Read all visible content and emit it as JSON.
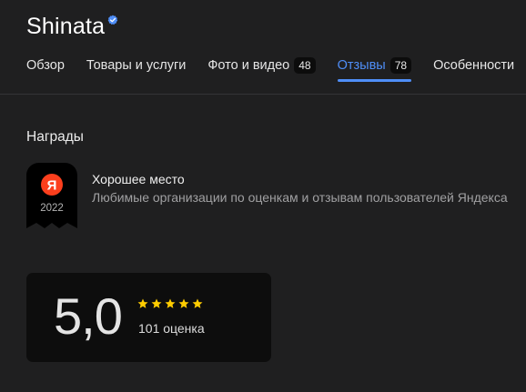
{
  "header": {
    "org_name": "Shinata",
    "verified_icon": "verified-check-icon"
  },
  "tabs": [
    {
      "label": "Обзор",
      "count": null,
      "active": false
    },
    {
      "label": "Товары и услуги",
      "count": null,
      "active": false
    },
    {
      "label": "Фото и видео",
      "count": "48",
      "active": false
    },
    {
      "label": "Отзывы",
      "count": "78",
      "active": true
    },
    {
      "label": "Особенности",
      "count": null,
      "active": false
    }
  ],
  "awards_section": {
    "title": "Награды",
    "award": {
      "badge_logo": "Я",
      "badge_year": "2022",
      "name": "Хорошее место",
      "description": "Любимые организации по оценкам и отзывам пользователей Яндекса"
    }
  },
  "rating": {
    "value": "5,0",
    "stars": 5,
    "count_text": "101 оценка"
  },
  "colors": {
    "background": "#1f1f20",
    "accent": "#4f8ef7",
    "star": "#ffcc00",
    "yandex_red": "#fc3f1d",
    "card": "#0d0d0d"
  }
}
